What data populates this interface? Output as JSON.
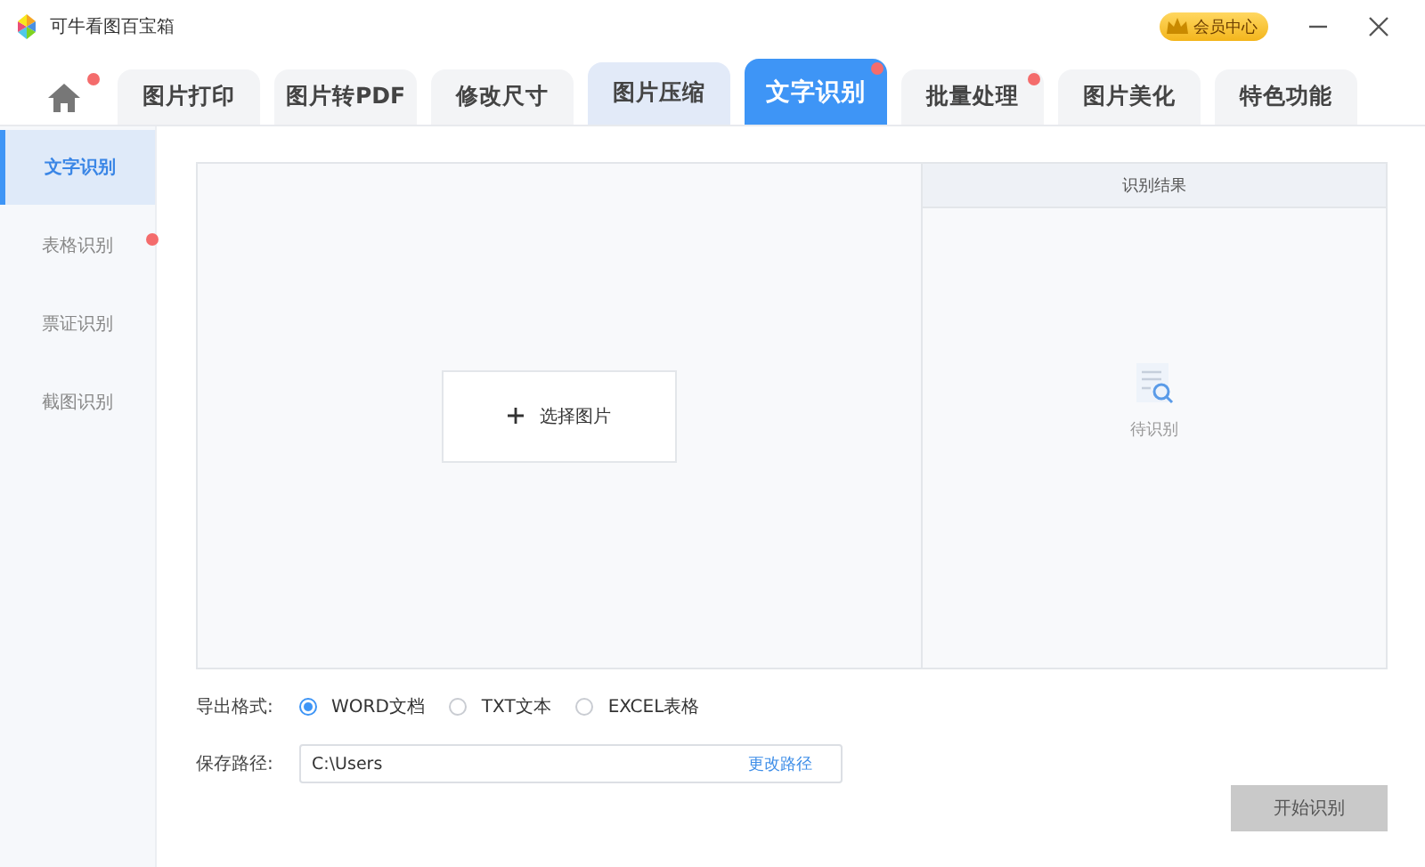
{
  "window": {
    "title": "可牛看图百宝箱",
    "vip_button": "会员中心"
  },
  "tabs": [
    {
      "kind": "home",
      "selected": false,
      "highlighted": false,
      "badge": true
    },
    {
      "kind": "text",
      "label": "图片打印",
      "selected": false,
      "highlighted": false,
      "badge": false
    },
    {
      "kind": "text",
      "label": "图片转PDF",
      "selected": false,
      "highlighted": false,
      "badge": false
    },
    {
      "kind": "text",
      "label": "修改尺寸",
      "selected": false,
      "highlighted": false,
      "badge": false
    },
    {
      "kind": "text",
      "label": "图片压缩",
      "selected": false,
      "highlighted": true,
      "badge": false
    },
    {
      "kind": "text",
      "label": "文字识别",
      "selected": true,
      "highlighted": false,
      "badge": true
    },
    {
      "kind": "text",
      "label": "批量处理",
      "selected": false,
      "highlighted": false,
      "badge": true
    },
    {
      "kind": "text",
      "label": "图片美化",
      "selected": false,
      "highlighted": false,
      "badge": false
    },
    {
      "kind": "text",
      "label": "特色功能",
      "selected": false,
      "highlighted": false,
      "badge": false
    }
  ],
  "sidebar": {
    "items": [
      {
        "label": "文字识别",
        "selected": true,
        "badge": false
      },
      {
        "label": "表格识别",
        "selected": false,
        "badge": true
      },
      {
        "label": "票证识别",
        "selected": false,
        "badge": false
      },
      {
        "label": "截图识别",
        "selected": false,
        "badge": false
      }
    ]
  },
  "upload": {
    "button": "选择图片"
  },
  "result": {
    "title": "识别结果",
    "empty_text": "待识别"
  },
  "export": {
    "label": "导出格式:",
    "options": [
      {
        "label": "WORD文档",
        "selected": true
      },
      {
        "label": "TXT文本",
        "selected": false
      },
      {
        "label": "EXCEL表格",
        "selected": false
      }
    ]
  },
  "save_path": {
    "label": "保存路径:",
    "value": "C:\\Users",
    "change_link": "更改路径"
  },
  "start_button": {
    "label": "开始识别",
    "disabled": true
  }
}
